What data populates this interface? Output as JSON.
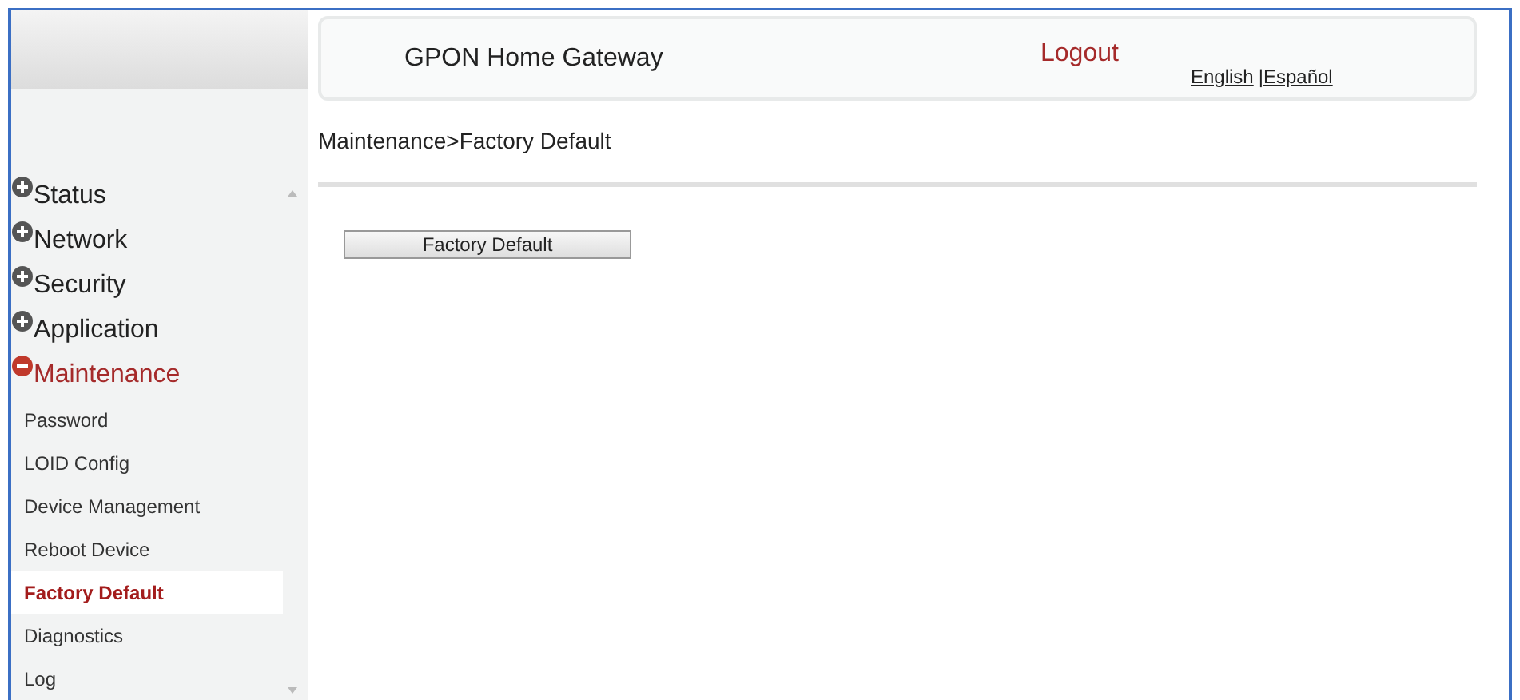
{
  "header": {
    "title": "GPON Home Gateway",
    "logout": "Logout",
    "languages": [
      "English",
      "|Español"
    ]
  },
  "breadcrumb": "Maintenance>Factory Default",
  "sidebar": {
    "items": [
      {
        "label": "Status",
        "expanded": false
      },
      {
        "label": "Network",
        "expanded": false
      },
      {
        "label": "Security",
        "expanded": false
      },
      {
        "label": "Application",
        "expanded": false
      },
      {
        "label": "Maintenance",
        "expanded": true,
        "children": [
          {
            "label": "Password",
            "selected": false
          },
          {
            "label": "LOID Config",
            "selected": false
          },
          {
            "label": "Device Management",
            "selected": false
          },
          {
            "label": "Reboot Device",
            "selected": false
          },
          {
            "label": "Factory Default",
            "selected": true
          },
          {
            "label": "Diagnostics",
            "selected": false
          },
          {
            "label": "Log",
            "selected": false
          }
        ]
      }
    ]
  },
  "action_button": "Factory Default"
}
